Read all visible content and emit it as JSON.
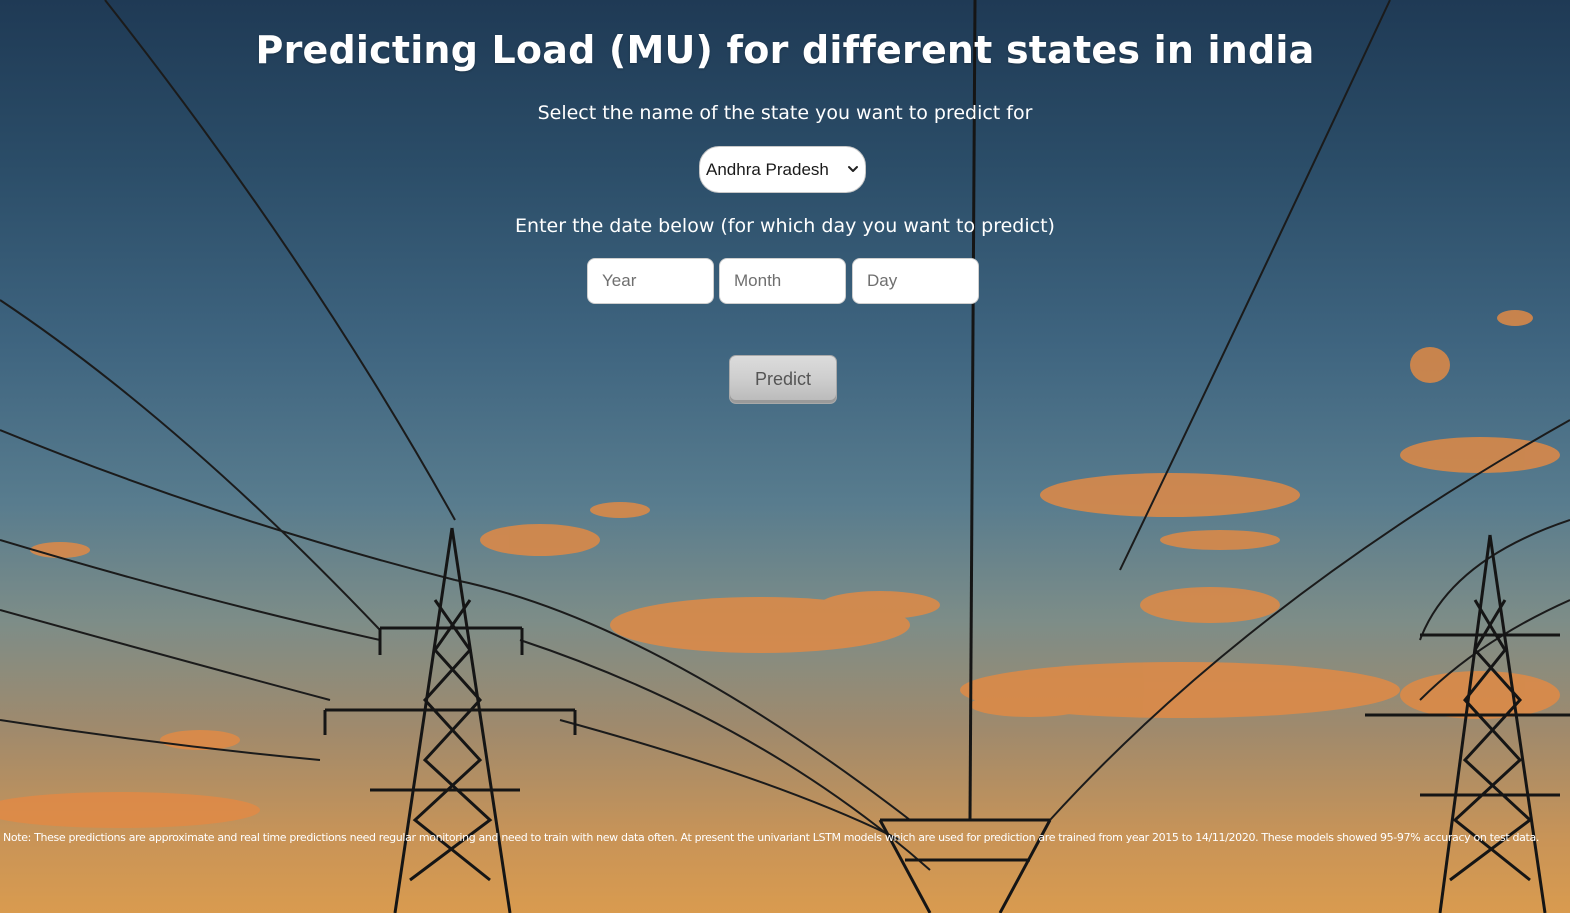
{
  "page": {
    "title": "Predicting Load (MU) for different states in india"
  },
  "state_section": {
    "label": "Select the name of the state you want to predict for",
    "selected_state": "Andhra Pradesh"
  },
  "date_section": {
    "label": "Enter the date below (for which day you want to predict)",
    "year_placeholder": "Year",
    "month_placeholder": "Month",
    "day_placeholder": "Day"
  },
  "actions": {
    "predict_label": "Predict"
  },
  "footer": {
    "note": "Note: These predictions are approximate and real time predictions need regular monitoring and need to train with new data often. At present the univariant LSTM models which are used for prediction are trained from year 2015 to 14/11/2020. These models showed 95-97% accuracy on test data."
  },
  "colors": {
    "sky_top": "#1f3a55",
    "sky_bottom": "#d99b4f",
    "cloud": "#e08a45",
    "tower": "#1a1a1a"
  },
  "icons": {
    "dropdown": "chevron-down-icon"
  }
}
